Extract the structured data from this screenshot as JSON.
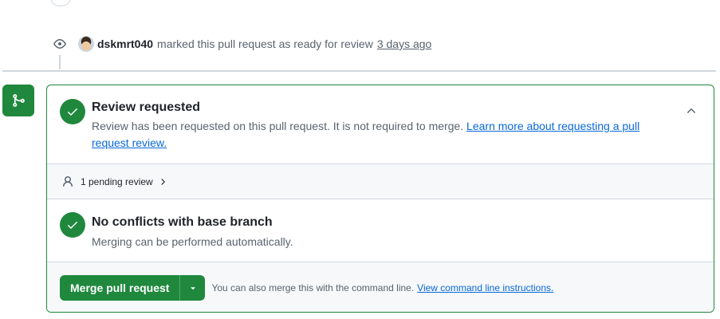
{
  "timeline_event": {
    "icon": "eye-icon",
    "actor": "dskmrt040",
    "text": "marked this pull request as ready for review",
    "time": "3 days ago"
  },
  "merge_badge": {
    "icon": "git-merge-icon",
    "color": "#1f883d"
  },
  "review_section": {
    "title": "Review requested",
    "description": "Review has been requested on this pull request. It is not required to merge.",
    "link_text": "Learn more about requesting a pull request review."
  },
  "pending": {
    "icon": "person-icon",
    "label": "1 pending review"
  },
  "conflicts_section": {
    "title": "No conflicts with base branch",
    "description": "Merging can be performed automatically."
  },
  "merge_action": {
    "button_label": "Merge pull request",
    "hint": "You can also merge this with the command line.",
    "hint_link": "View command line instructions."
  },
  "colors": {
    "success": "#1f883d",
    "link": "#0969da",
    "muted_text": "#59636e",
    "border": "#d0d7de"
  }
}
